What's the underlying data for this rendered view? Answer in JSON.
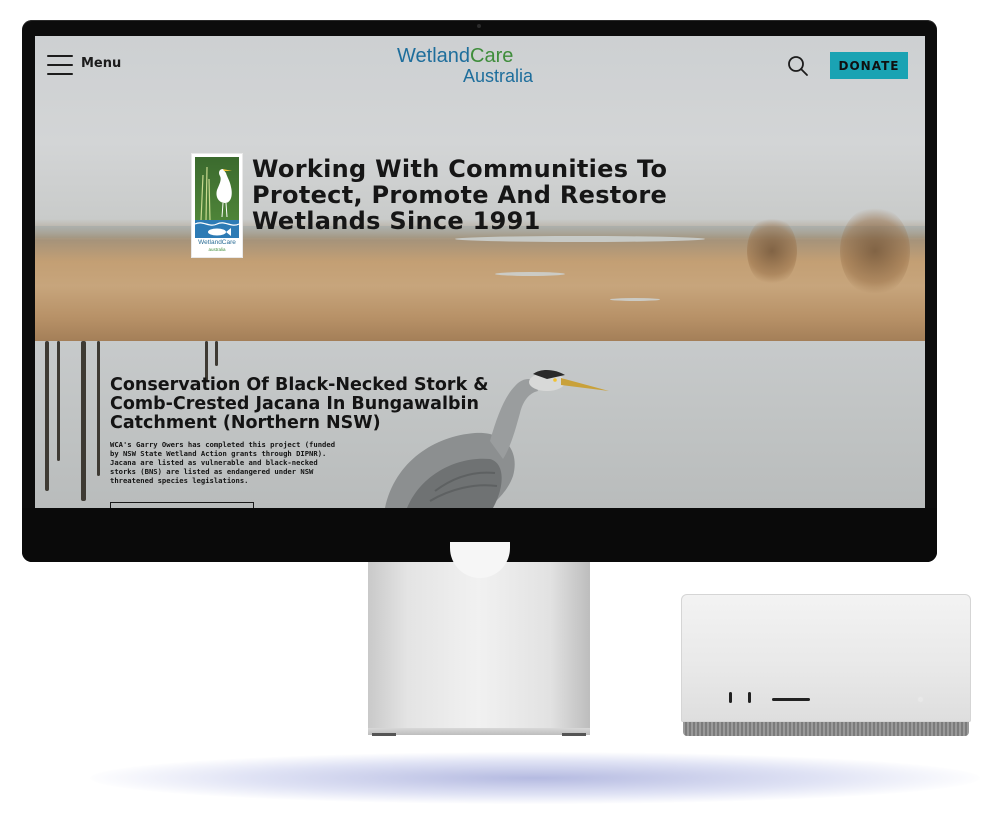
{
  "nav": {
    "menu_label": "Menu",
    "brand_wetland": "Wetland",
    "brand_care": "Care",
    "brand_country": "Australia",
    "search_icon": "search-icon",
    "donate_label": "DONATE"
  },
  "hero": {
    "headline": "Working With Communities To Protect, Promote And Restore Wetlands Since 1991",
    "badge_name": "WetlandCare",
    "badge_sub": "australia"
  },
  "article": {
    "title": "Conservation Of Black-Necked Stork & Comb-Crested Jacana In Bungawalbin Catchment (Northern NSW)",
    "body": "WCA's Garry Owers has completed this project (funded by NSW State Wetland Action grants through DIPNR). Jacana are listed as vulnerable and black-necked storks (BNS) are listed as endangered under NSW threatened species legislations."
  },
  "colors": {
    "brand_blue": "#1e6e9c",
    "brand_green": "#3f8d3b",
    "donate_bg": "#1aa3b3"
  }
}
